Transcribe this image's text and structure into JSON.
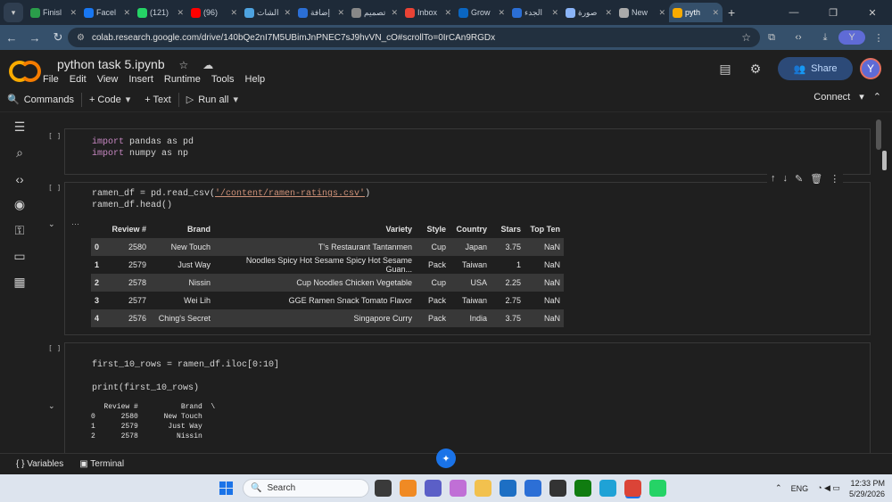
{
  "browser": {
    "tabs": [
      {
        "label": "Finisl",
        "color": "#2a9d4a",
        "active": false
      },
      {
        "label": "Facel",
        "color": "#1877f2",
        "active": false
      },
      {
        "label": "(121)",
        "color": "#25d366",
        "active": false
      },
      {
        "label": "(96)",
        "color": "#ff0000",
        "active": false
      },
      {
        "label": "الشات",
        "color": "#4ea3e0",
        "active": false
      },
      {
        "label": "إضافة",
        "color": "#2b6fd6",
        "active": false
      },
      {
        "label": "تصميم",
        "color": "#888888",
        "active": false
      },
      {
        "label": "Inbox",
        "color": "#ea4335",
        "active": false
      },
      {
        "label": "Grow",
        "color": "#0a66c2",
        "active": false
      },
      {
        "label": "الجدء",
        "color": "#2b6fd6",
        "active": false
      },
      {
        "label": "صورة",
        "color": "#8ab4f8",
        "active": false
      },
      {
        "label": "New",
        "color": "#aaaaaa",
        "active": false
      },
      {
        "label": "pyth",
        "color": "#f9ab00",
        "active": true
      }
    ],
    "new_tab": "+",
    "url": "colab.research.google.com/drive/140bQe2nI7M5UBimJnPNEC7sJ9hvVN_cO#scrollTo=0IrCAn9RGDx"
  },
  "colab": {
    "notebook_title": "python task 5.ipynb",
    "menu": [
      "File",
      "Edit",
      "View",
      "Insert",
      "Runtime",
      "Tools",
      "Help"
    ],
    "share_label": "Share",
    "user_initial": "Y",
    "toolbar": {
      "commands": "Commands",
      "code": "+ Code",
      "text": "+ Text",
      "run_all": "Run all",
      "connect": "Connect"
    }
  },
  "cells": {
    "cell1": {
      "marker": "[ ]",
      "line1_kw": "import",
      "line1_rest": " pandas as pd",
      "line2_kw": "import",
      "line2_rest": " numpy as np"
    },
    "cell2": {
      "marker": "[ ]",
      "line1_pre": "ramen_df = pd.read_csv(",
      "line1_str": "'/content/ramen-ratings.csv'",
      "line1_post": ")",
      "line2": "ramen_df.head()",
      "table": {
        "columns": [
          "",
          "Review #",
          "Brand",
          "Variety",
          "Style",
          "Country",
          "Stars",
          "Top Ten"
        ],
        "rows": [
          [
            "0",
            "2580",
            "New Touch",
            "T's Restaurant Tantanmen",
            "Cup",
            "Japan",
            "3.75",
            "NaN"
          ],
          [
            "1",
            "2579",
            "Just Way",
            "Noodles Spicy Hot Sesame Spicy Hot Sesame Guan...",
            "Pack",
            "Taiwan",
            "1",
            "NaN"
          ],
          [
            "2",
            "2578",
            "Nissin",
            "Cup Noodles Chicken Vegetable",
            "Cup",
            "USA",
            "2.25",
            "NaN"
          ],
          [
            "3",
            "2577",
            "Wei Lih",
            "GGE Ramen Snack Tomato Flavor",
            "Pack",
            "Taiwan",
            "2.75",
            "NaN"
          ],
          [
            "4",
            "2576",
            "Ching's Secret",
            "Singapore Curry",
            "Pack",
            "India",
            "3.75",
            "NaN"
          ]
        ]
      }
    },
    "cell3": {
      "marker": "[ ]",
      "line1": "first_10_rows = ramen_df.iloc[0:10]",
      "line2": "print(first_10_rows)",
      "output": [
        "   Review #          Brand  \\",
        "0      2580      New Touch",
        "1      2579       Just Way",
        "2      2578         Nissin"
      ]
    }
  },
  "bottom": {
    "variables": "Variables",
    "terminal": "Terminal"
  },
  "taskbar": {
    "search_placeholder": "Search",
    "lang": "ENG",
    "time": "12:33 PM",
    "date": "5/29/2026"
  }
}
